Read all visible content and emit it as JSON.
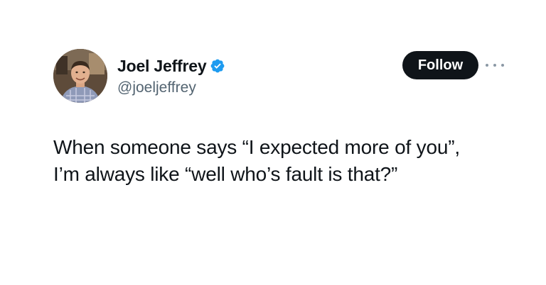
{
  "author": {
    "name": "Joel Jeffrey",
    "handle": "@joeljeffrey",
    "verified_icon": "verified-badge-icon",
    "avatar_icon": "profile-photo"
  },
  "actions": {
    "follow_label": "Follow",
    "more_icon": "more-options-icon"
  },
  "tweet": {
    "lines": [
      "When someone says “I expected more of you”,",
      "I’m always like “well who’s fault is that?”"
    ]
  },
  "colors": {
    "text_primary": "#0f1419",
    "text_secondary": "#536471",
    "verified_blue": "#1d9bf0",
    "follow_bg": "#0f1419",
    "follow_text": "#ffffff"
  }
}
